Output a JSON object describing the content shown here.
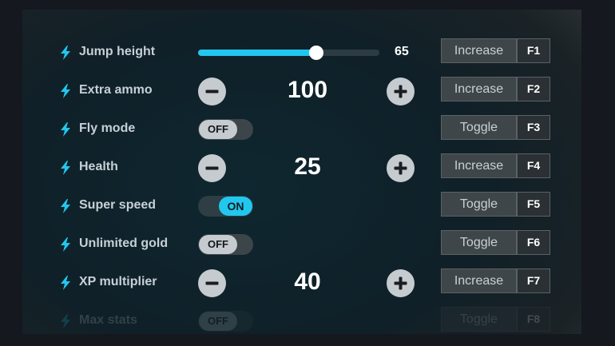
{
  "colors": {
    "accent": "#22c7ee",
    "background": "#15181f",
    "button": "#3f4649",
    "text": "#c7d0d6"
  },
  "rows": [
    {
      "label": "Jump height",
      "icon": "lightning-bolt-icon",
      "control": "slider",
      "slider_value": "65",
      "slider_fraction": 0.65,
      "action": "Increase",
      "hotkey": "F1"
    },
    {
      "label": "Extra ammo",
      "icon": "lightning-bolt-icon",
      "control": "stepper",
      "value": "100",
      "action": "Increase",
      "hotkey": "F2"
    },
    {
      "label": "Fly mode",
      "icon": "lightning-bolt-icon",
      "control": "toggle",
      "toggle_state": "OFF",
      "action": "Toggle",
      "hotkey": "F3"
    },
    {
      "label": "Health",
      "icon": "lightning-bolt-icon",
      "control": "stepper",
      "value": "25",
      "action": "Increase",
      "hotkey": "F4"
    },
    {
      "label": "Super speed",
      "icon": "lightning-bolt-icon",
      "control": "toggle",
      "toggle_state": "ON",
      "action": "Toggle",
      "hotkey": "F5"
    },
    {
      "label": "Unlimited gold",
      "icon": "lightning-bolt-icon",
      "control": "toggle",
      "toggle_state": "OFF",
      "action": "Toggle",
      "hotkey": "F6"
    },
    {
      "label": "XP multiplier",
      "icon": "lightning-bolt-icon",
      "control": "stepper",
      "value": "40",
      "action": "Increase",
      "hotkey": "F7"
    },
    {
      "label": "Max stats",
      "icon": "lightning-bolt-icon",
      "control": "toggle",
      "toggle_state": "OFF",
      "action": "Toggle",
      "hotkey": "F8"
    }
  ]
}
